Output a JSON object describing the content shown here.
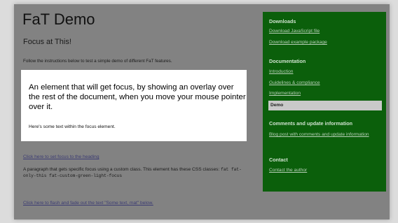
{
  "page": {
    "title": "FaT Demo",
    "subtitle": "Focus at This!",
    "instructions": "Follow the instructions below to test a simple demo of different FaT features."
  },
  "focus_element": {
    "main_text": "An element that will get focus, by showing an overlay over the rest of the document, when you move your mouse pointer over it.",
    "sub_text": "Here's some text within the focus element."
  },
  "links": {
    "focus_heading": "Click here to set focus to the heading",
    "flash_text": "Click here to flash and fade out the text \"Some text, mat\" below."
  },
  "paragraph": {
    "text": "A paragraph that gets specific focus using a custom class. This element has these CSS classes:",
    "classes": "fat fat-only-this fat-custom-green-light-focus"
  },
  "sidebar": {
    "downloads": {
      "heading": "Downloads",
      "items": [
        "Download JavaScript file",
        "Download example package"
      ]
    },
    "documentation": {
      "heading": "Documentation",
      "items": [
        "Introduction",
        "Guidelines & compliance",
        "Implementation"
      ],
      "current": "Demo"
    },
    "comments": {
      "heading": "Comments and update information",
      "items": [
        "Blog post with comments and update information"
      ]
    },
    "contact": {
      "heading": "Contact",
      "items": [
        "Contact the author"
      ]
    }
  },
  "colors": {
    "overlay": "#828282",
    "sidebar": "#0b5f0b",
    "focus_box": "#ffffff"
  }
}
